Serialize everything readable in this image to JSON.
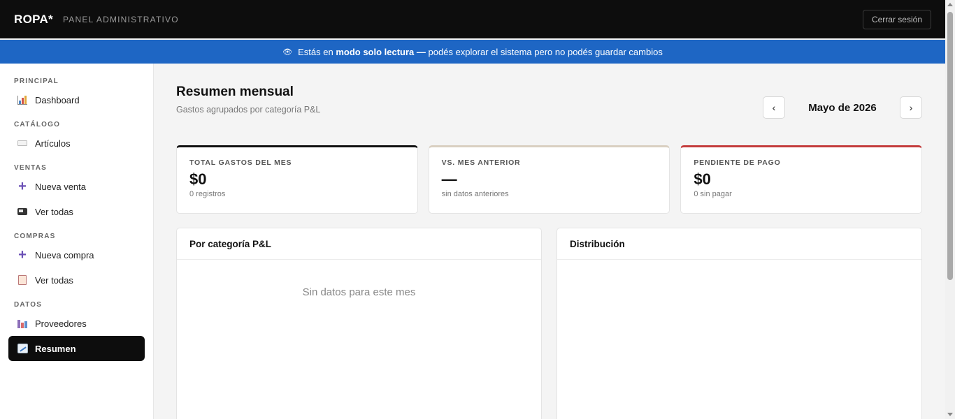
{
  "topbar": {
    "brand": "ROPA*",
    "subtitle": "PANEL ADMINISTRATIVO",
    "logout_label": "Cerrar sesión"
  },
  "banner": {
    "icon": "eye-icon",
    "prefix": "Estás en",
    "bold": "modo solo lectura —",
    "suffix": "podés explorar el sistema pero no podés guardar cambios",
    "color": "#1e66c4"
  },
  "sidebar": {
    "sections": [
      {
        "title": "PRINCIPAL",
        "items": [
          {
            "label": "Dashboard",
            "icon": "bar-chart-icon"
          }
        ]
      },
      {
        "title": "CATÁLOGO",
        "items": [
          {
            "label": "Artículos",
            "icon": "tag-icon"
          }
        ]
      },
      {
        "title": "VENTAS",
        "items": [
          {
            "label": "Nueva venta",
            "icon": "plus-icon"
          },
          {
            "label": "Ver todas",
            "icon": "truck-icon"
          }
        ]
      },
      {
        "title": "COMPRAS",
        "items": [
          {
            "label": "Nueva compra",
            "icon": "plus-icon"
          },
          {
            "label": "Ver todas",
            "icon": "clipboard-icon"
          }
        ]
      },
      {
        "title": "DATOS",
        "items": [
          {
            "label": "Proveedores",
            "icon": "factory-icon"
          },
          {
            "label": "Resumen",
            "icon": "trend-chart-icon",
            "active": true
          }
        ]
      }
    ]
  },
  "main": {
    "title": "Resumen mensual",
    "subtitle": "Gastos agrupados por categoría P&L",
    "month": "Mayo de 2026",
    "prev_label": "‹",
    "next_label": "›",
    "cards": [
      {
        "label": "TOTAL GASTOS DEL MES",
        "value": "$0",
        "note": "0 registros"
      },
      {
        "label": "VS. MES ANTERIOR",
        "value": "—",
        "note": "sin datos anteriores"
      },
      {
        "label": "PENDIENTE DE PAGO",
        "value": "$0",
        "note": "0 sin pagar"
      }
    ],
    "panels": [
      {
        "title": "Por categoría P&L",
        "empty": "Sin datos para este mes"
      },
      {
        "title": "Distribución"
      }
    ]
  }
}
